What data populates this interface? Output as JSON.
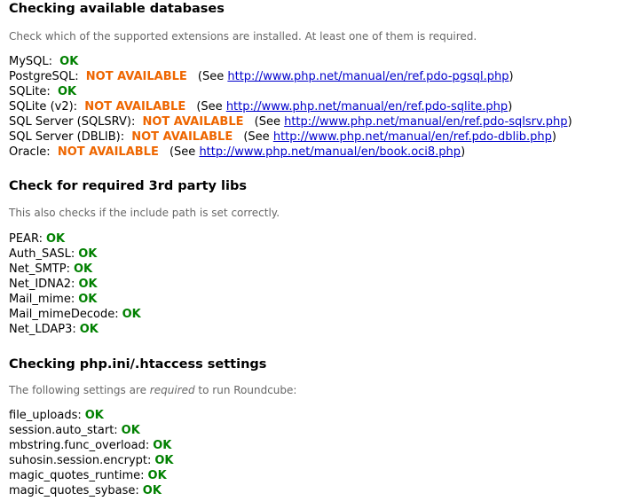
{
  "databases": {
    "title": "Checking available databases",
    "hint": "Check which of the supported extensions are installed. At least one of them is required.",
    "items": [
      {
        "name": "MySQL:",
        "status": "OK"
      },
      {
        "name": "PostgreSQL:",
        "status": "NOT AVAILABLE",
        "see_prefix": "(See",
        "link": "http://www.php.net/manual/en/ref.pdo-pgsql.php",
        "see_suffix": ")"
      },
      {
        "name": "SQLite:",
        "status": "OK"
      },
      {
        "name": "SQLite (v2):",
        "status": "NOT AVAILABLE",
        "see_prefix": "(See",
        "link": "http://www.php.net/manual/en/ref.pdo-sqlite.php",
        "see_suffix": ")"
      },
      {
        "name": "SQL Server (SQLSRV):",
        "status": "NOT AVAILABLE",
        "see_prefix": "(See",
        "link": "http://www.php.net/manual/en/ref.pdo-sqlsrv.php",
        "see_suffix": ")"
      },
      {
        "name": "SQL Server (DBLIB):",
        "status": "NOT AVAILABLE",
        "see_prefix": "(See",
        "link": "http://www.php.net/manual/en/ref.pdo-dblib.php",
        "see_suffix": ")"
      },
      {
        "name": "Oracle:",
        "status": "NOT AVAILABLE",
        "see_prefix": "(See",
        "link": "http://www.php.net/manual/en/book.oci8.php",
        "see_suffix": ")"
      }
    ]
  },
  "libs": {
    "title": "Check for required 3rd party libs",
    "hint": "This also checks if the include path is set correctly.",
    "items": [
      {
        "name": "PEAR:",
        "status": "OK"
      },
      {
        "name": "Auth_SASL:",
        "status": "OK"
      },
      {
        "name": "Net_SMTP:",
        "status": "OK"
      },
      {
        "name": "Net_IDNA2:",
        "status": "OK"
      },
      {
        "name": "Mail_mime:",
        "status": "OK"
      },
      {
        "name": "Mail_mimeDecode:",
        "status": "OK"
      },
      {
        "name": "Net_LDAP3:",
        "status": "OK"
      }
    ]
  },
  "settings": {
    "title": "Checking php.ini/.htaccess settings",
    "hint_before": "The following settings are ",
    "hint_em": "required",
    "hint_after": " to run Roundcube:",
    "items": [
      {
        "name": "file_uploads:",
        "status": "OK"
      },
      {
        "name": "session.auto_start:",
        "status": "OK"
      },
      {
        "name": "mbstring.func_overload:",
        "status": "OK"
      },
      {
        "name": "suhosin.session.encrypt:",
        "status": "OK"
      },
      {
        "name": "magic_quotes_runtime:",
        "status": "OK"
      },
      {
        "name": "magic_quotes_sybase:",
        "status": "OK"
      }
    ]
  },
  "colors": {
    "ok": "#008000",
    "not_available": "#ee6600",
    "link": "#0000cc",
    "hint": "#666666"
  }
}
